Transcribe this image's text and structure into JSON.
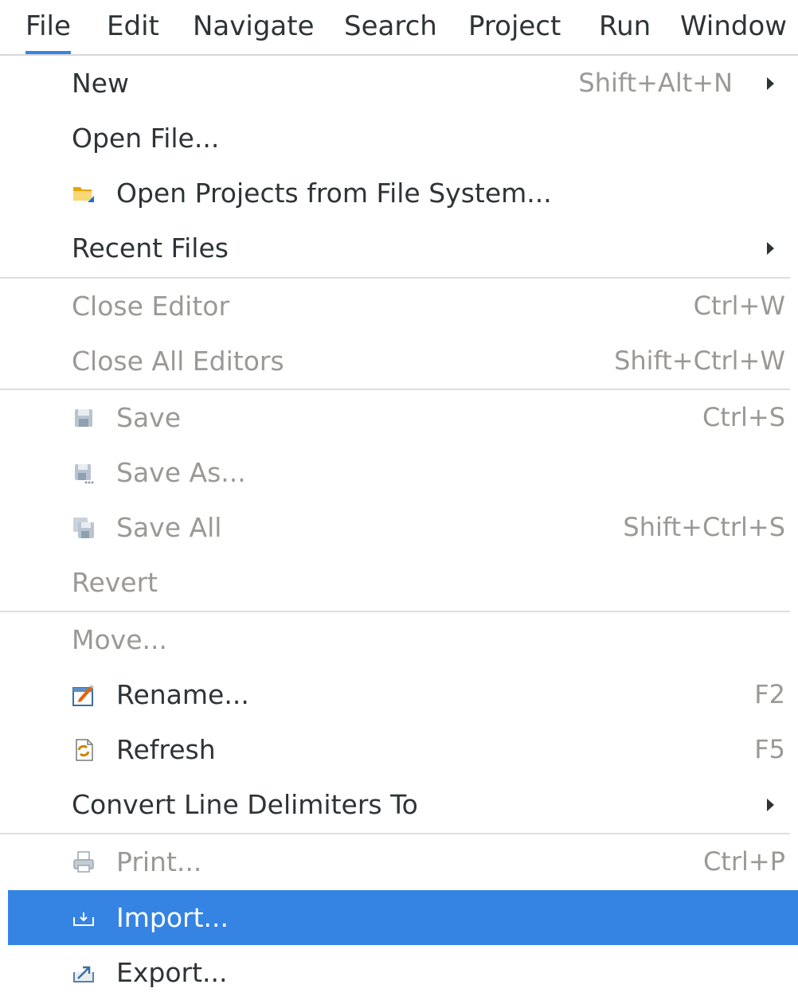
{
  "menubar": {
    "file": "File",
    "edit": "Edit",
    "navigate": "Navigate",
    "search": "Search",
    "project": "Project",
    "run": "Run",
    "window": "Window"
  },
  "menu": {
    "new": {
      "label": "New",
      "accel": "Shift+Alt+N"
    },
    "open_file": {
      "label": "Open File..."
    },
    "open_projects": {
      "label": "Open Projects from File System..."
    },
    "recent_files": {
      "label": "Recent Files"
    },
    "close_editor": {
      "label": "Close Editor",
      "accel": "Ctrl+W"
    },
    "close_all_editors": {
      "label": "Close All Editors",
      "accel": "Shift+Ctrl+W"
    },
    "save": {
      "label": "Save",
      "accel": "Ctrl+S"
    },
    "save_as": {
      "label": "Save As..."
    },
    "save_all": {
      "label": "Save All",
      "accel": "Shift+Ctrl+S"
    },
    "revert": {
      "label": "Revert"
    },
    "move": {
      "label": "Move..."
    },
    "rename": {
      "label": "Rename...",
      "accel": "F2"
    },
    "refresh": {
      "label": "Refresh",
      "accel": "F5"
    },
    "convert_line_delimiters": {
      "label": "Convert Line Delimiters To"
    },
    "print": {
      "label": "Print...",
      "accel": "Ctrl+P"
    },
    "import": {
      "label": "Import..."
    },
    "export": {
      "label": "Export..."
    }
  },
  "icons": {
    "open_projects": "folder-open-icon",
    "save": "save-icon",
    "save_as": "save-as-icon",
    "save_all": "save-all-icon",
    "rename": "rename-icon",
    "refresh": "refresh-icon",
    "print": "print-icon",
    "import": "import-icon",
    "export": "export-icon"
  },
  "colors": {
    "highlight": "#3584e4",
    "disabled_text": "#9a9996",
    "text": "#2e3436"
  }
}
